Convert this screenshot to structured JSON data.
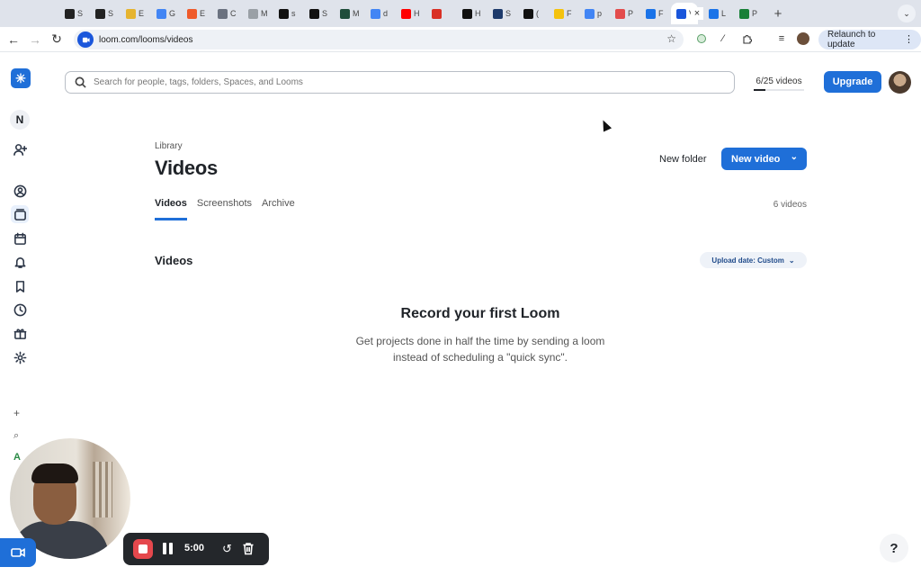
{
  "browser": {
    "tabs": [
      {
        "label": "S",
        "color": "#222222"
      },
      {
        "label": "S",
        "color": "#222222"
      },
      {
        "label": "E",
        "color": "#e6b430"
      },
      {
        "label": "G",
        "color": "#4285f4"
      },
      {
        "label": "E",
        "color": "#ef5a2a"
      },
      {
        "label": "C",
        "color": "#6b7280"
      },
      {
        "label": "M",
        "color": "#9aa0a6"
      },
      {
        "label": "s",
        "color": "#111111"
      },
      {
        "label": "S",
        "color": "#111111"
      },
      {
        "label": "M",
        "color": "#1f4d3b"
      },
      {
        "label": "d",
        "color": "#4285f4"
      },
      {
        "label": "H",
        "color": "#ff0000"
      },
      {
        "label": "",
        "color": "#d93025"
      },
      {
        "label": "H",
        "color": "#111111"
      },
      {
        "label": "S",
        "color": "#1d3a6b"
      },
      {
        "label": "(",
        "color": "#111111"
      },
      {
        "label": "F",
        "color": "#f4c20d"
      },
      {
        "label": "p",
        "color": "#4285f4"
      },
      {
        "label": "P",
        "color": "#e34c4c"
      },
      {
        "label": "F",
        "color": "#1a73e8"
      }
    ],
    "active_tab": {
      "label": "V",
      "color": "#1a56db"
    },
    "after_tabs": [
      {
        "label": "L",
        "color": "#1a73e8"
      },
      {
        "label": "P",
        "color": "#188038"
      }
    ],
    "tab_close_icon": "×",
    "new_tab_icon": "+",
    "url": "loom.com/looms/videos",
    "relaunch_label": "Relaunch to update"
  },
  "app": {
    "search_placeholder": "Search for people, tags, folders, Spaces, and Looms",
    "video_count": "6/25 videos",
    "video_quota_fraction": 0.24,
    "upgrade_label": "Upgrade",
    "workspace_initial": "N",
    "breadcrumb": "Library",
    "page_title": "Videos",
    "new_folder_label": "New folder",
    "new_video_label": "New video",
    "tabs": [
      {
        "label": "Videos",
        "active": true
      },
      {
        "label": "Screenshots",
        "active": false
      },
      {
        "label": "Archive",
        "active": false
      }
    ],
    "tab_count": "6 videos",
    "section_title": "Videos",
    "sort_label": "Upload date: Custom",
    "empty_title": "Record your first Loom",
    "empty_line1": "Get projects done in half the time by sending a loom",
    "empty_line2": "instead of scheduling a \"quick sync\".",
    "sidebar_a": "A"
  },
  "recorder": {
    "timer": "5:00",
    "help_label": "?"
  },
  "colors": {
    "accent": "#1f6fd8",
    "record_red": "#e5484d"
  }
}
